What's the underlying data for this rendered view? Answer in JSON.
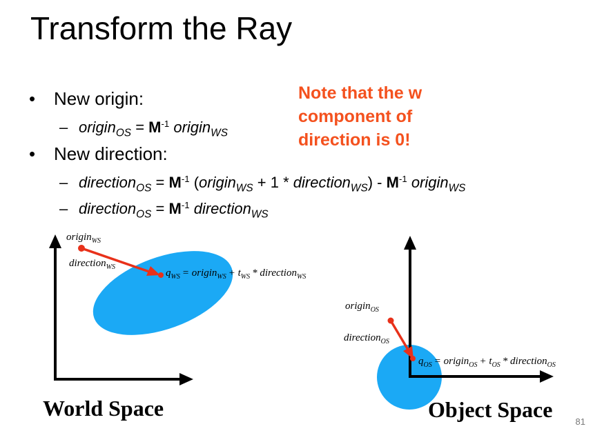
{
  "title": "Transform the Ray",
  "bullets": {
    "b1": "New origin:",
    "b2": "New direction:"
  },
  "note": [
    "Note that the w",
    "component of",
    "direction is 0!"
  ],
  "formulas": {
    "origin": {
      "lhs": "origin",
      "lhs_sub": "OS",
      "eq": "=",
      "m": "M",
      "inv": "-1",
      "rhs": "origin",
      "rhs_sub": "WS"
    },
    "dir1": {
      "lhs": "direction",
      "lhs_sub": "OS",
      "eq": "=",
      "m": "M",
      "inv": "-1",
      "open": "(",
      "a": "origin",
      "a_sub": "WS",
      "plus": "+ 1 *",
      "b": "direction",
      "b_sub": "WS",
      "close": ")",
      "minus": "-",
      "m2": "M",
      "inv2": "-1",
      "c": "origin",
      "c_sub": "WS"
    },
    "dir2": {
      "lhs": "direction",
      "lhs_sub": "OS",
      "eq": "=",
      "m": "M",
      "inv": "-1",
      "rhs": "direction",
      "rhs_sub": "WS"
    }
  },
  "world": {
    "caption": "World Space",
    "origin_label": "origin",
    "origin_sub": "WS",
    "direction_label": "direction",
    "direction_sub": "WS",
    "eq": {
      "q": "q",
      "q_sub": "WS",
      "eq": "= origin",
      "s1": "WS",
      "plus": "+ t",
      "s2": "WS",
      "times": "* direction",
      "s3": "WS"
    }
  },
  "object": {
    "caption": "Object Space",
    "origin_label": "origin",
    "origin_sub": "OS",
    "direction_label": "direction",
    "direction_sub": "OS",
    "eq": {
      "q": "q",
      "q_sub": "OS",
      "eq": "= origin",
      "s1": "OS",
      "plus": "+ t",
      "s2": "OS",
      "times": "* direction",
      "s3": "OS"
    }
  },
  "colors": {
    "accent": "#f4511e",
    "ellipse": "#1ba9f5",
    "ray": "#e8311a"
  },
  "page_number": "81"
}
